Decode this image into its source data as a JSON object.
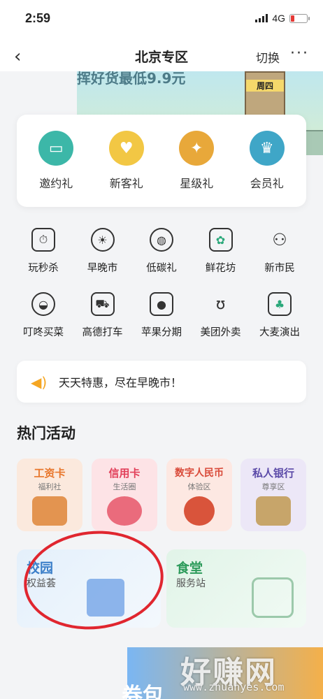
{
  "status_bar": {
    "time": "2:59",
    "network": "4G",
    "battery_color": "#e53935"
  },
  "nav": {
    "back_icon": "chevron-left-icon",
    "title": "北京专区",
    "switch_label": "切换",
    "more_label": "···"
  },
  "banner": {
    "slogan": "挥好货最低9.9元",
    "day_label": "周四"
  },
  "gifts": [
    {
      "label": "邀约礼",
      "icon": "chat-bubble-icon",
      "color": "#3cb7a8"
    },
    {
      "label": "新客礼",
      "icon": "heart-icon",
      "color": "#f2c744"
    },
    {
      "label": "星级礼",
      "icon": "star-badge-icon",
      "color": "#e8a83a"
    },
    {
      "label": "会员礼",
      "icon": "crown-icon",
      "color": "#3fa6c7"
    }
  ],
  "services_row1": [
    {
      "label": "玩秒杀",
      "icon": "flash-sale-icon",
      "glyph": "⏱"
    },
    {
      "label": "早晚市",
      "icon": "sun-moon-icon",
      "glyph": "☀"
    },
    {
      "label": "低碳礼",
      "icon": "earth-leaf-icon",
      "glyph": "◍"
    },
    {
      "label": "鲜花坊",
      "icon": "flower-pot-icon",
      "glyph": "✿"
    },
    {
      "label": "新市民",
      "icon": "people-icon",
      "glyph": "⚇"
    }
  ],
  "services_row2": [
    {
      "label": "叮咚买菜",
      "icon": "vegetable-bowl-icon",
      "glyph": "◒"
    },
    {
      "label": "高德打车",
      "icon": "car-icon",
      "glyph": "⛟"
    },
    {
      "label": "苹果分期",
      "icon": "apple-icon",
      "glyph": ""
    },
    {
      "label": "美团外卖",
      "icon": "kangaroo-icon",
      "glyph": "ʊ"
    },
    {
      "label": "大麦演出",
      "icon": "ticket-icon",
      "glyph": "♣"
    }
  ],
  "notice": {
    "icon": "speaker-icon",
    "text": "天天特惠，尽在早晚市！"
  },
  "hot_section": {
    "title": "热门活动"
  },
  "activities": [
    {
      "title": "工资卡",
      "subtitle": "福利社",
      "title_color": "#e8762b",
      "bg": "#fbe9dd",
      "deco": "#e39450"
    },
    {
      "title": "信用卡",
      "subtitle": "生活圈",
      "title_color": "#e2405a",
      "bg": "#fde3e6",
      "deco": "#ea6b7c"
    },
    {
      "title": "数字人民币",
      "subtitle": "体验区",
      "title_color": "#d94b3a",
      "bg": "#fde8e2",
      "deco": "#d9543b"
    },
    {
      "title": "私人银行",
      "subtitle": "尊享区",
      "title_color": "#5b4aa8",
      "bg": "#ece7f7",
      "deco": "#c7a56a"
    }
  ],
  "wide_cards": [
    {
      "title": "校园",
      "subtitle": "权益荟",
      "title_color": "#3c7fc9",
      "bg": "#e4f0fb"
    },
    {
      "title": "食堂",
      "subtitle": "服务站",
      "title_color": "#2d9b5b",
      "bg": "#e1f4e8"
    }
  ],
  "bottom_banner": {
    "text": "券包"
  },
  "watermark": {
    "main": "好赚网",
    "url": "www.zhuanyes.com"
  }
}
